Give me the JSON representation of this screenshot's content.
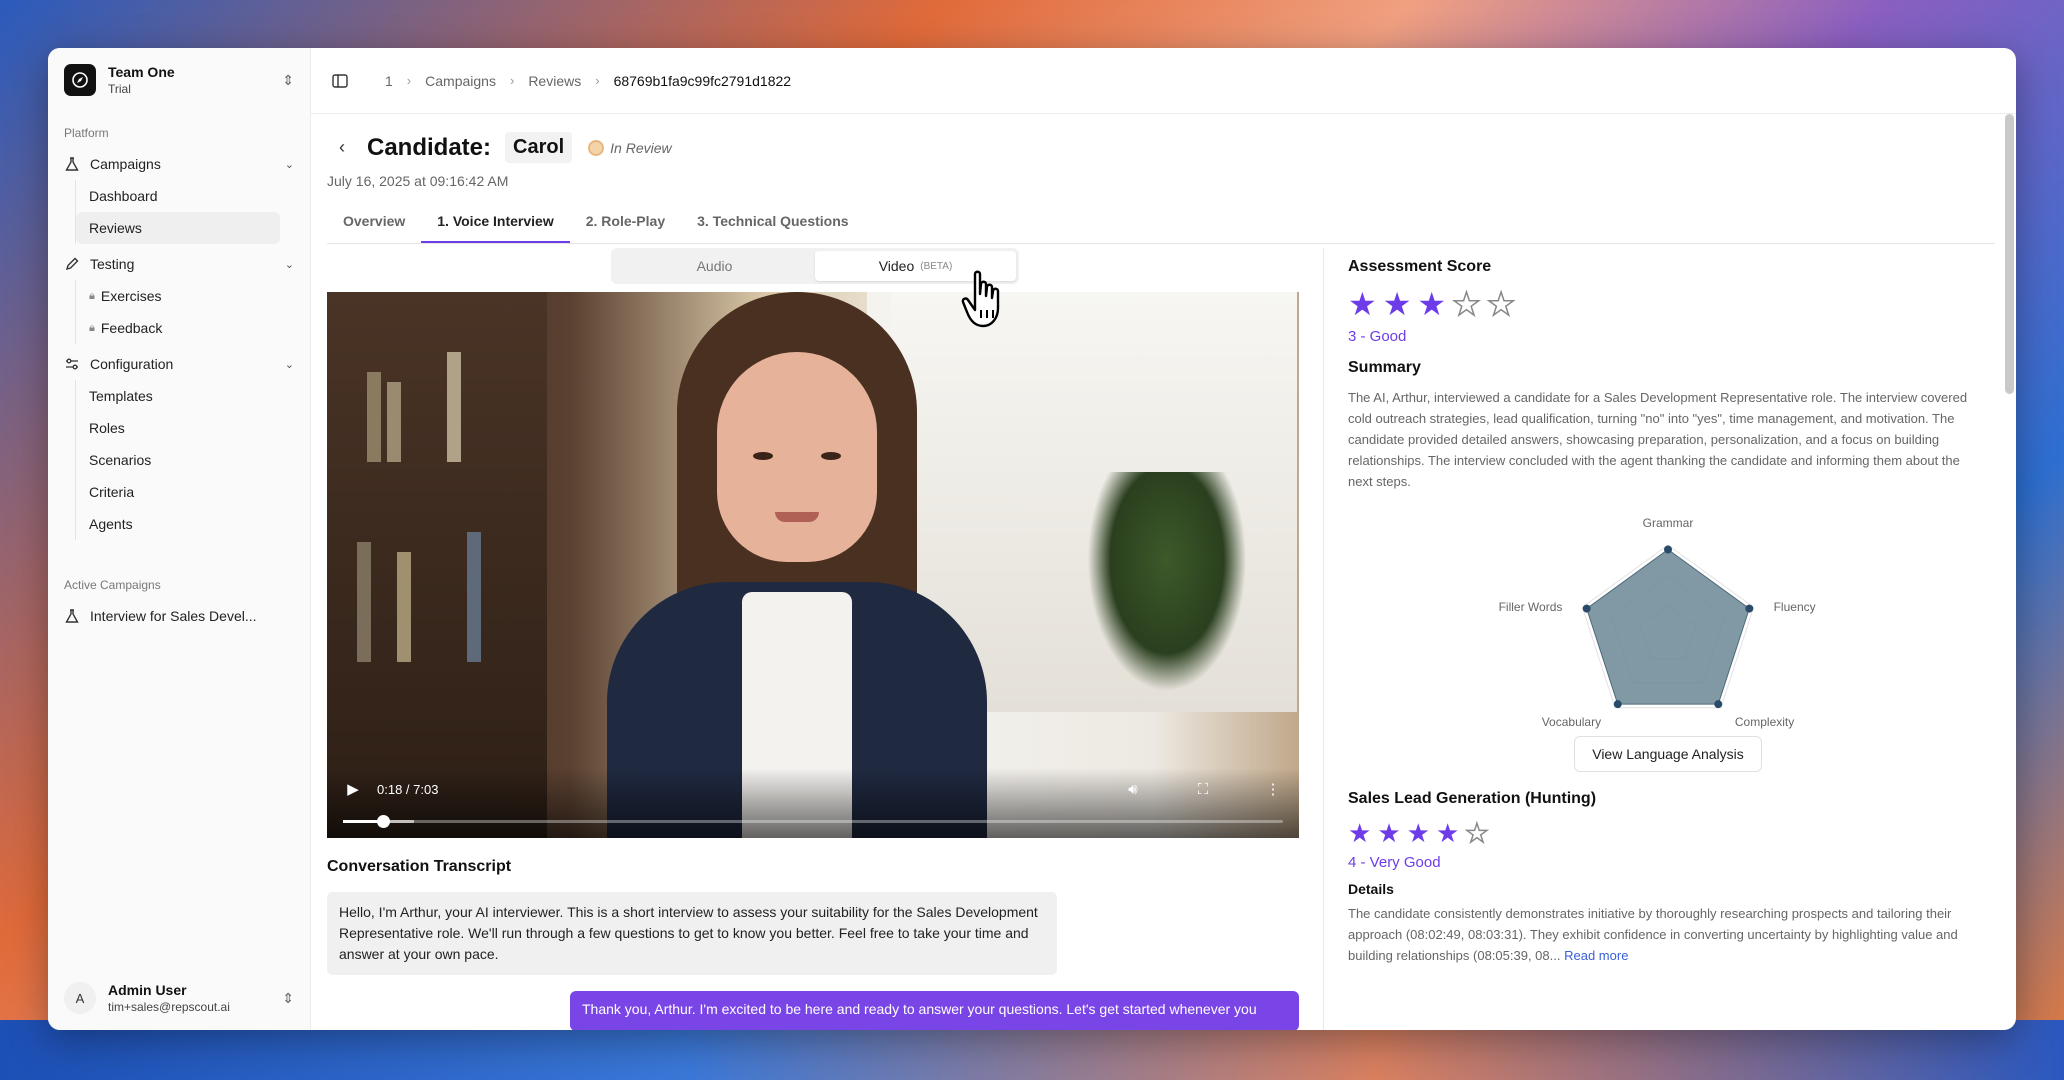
{
  "team": {
    "name": "Team One",
    "plan": "Trial"
  },
  "sidebar": {
    "platform_label": "Platform",
    "groups": [
      {
        "label": "Campaigns",
        "icon": "flask-icon",
        "items": [
          {
            "label": "Dashboard"
          },
          {
            "label": "Reviews",
            "active": true
          }
        ]
      },
      {
        "label": "Testing",
        "icon": "pencil-icon",
        "items": [
          {
            "label": "Exercises",
            "locked": true
          },
          {
            "label": "Feedback",
            "locked": true
          }
        ]
      },
      {
        "label": "Configuration",
        "icon": "sliders-icon",
        "items": [
          {
            "label": "Templates"
          },
          {
            "label": "Roles"
          },
          {
            "label": "Scenarios"
          },
          {
            "label": "Criteria"
          },
          {
            "label": "Agents"
          }
        ]
      }
    ],
    "active_campaigns_label": "Active Campaigns",
    "active_campaigns": [
      {
        "label": "Interview for Sales Devel..."
      }
    ]
  },
  "user": {
    "initial": "A",
    "name": "Admin User",
    "email": "tim+sales@repscout.ai"
  },
  "breadcrumb": [
    "1",
    "Campaigns",
    "Reviews",
    "68769b1fa9c99fc2791d1822"
  ],
  "candidate": {
    "title": "Candidate:",
    "name": "Carol",
    "status": "In Review",
    "date": "July 16, 2025 at 09:16:42 AM"
  },
  "tabs": [
    {
      "label": "Overview",
      "active": false
    },
    {
      "label": "1. Voice Interview",
      "active": true
    },
    {
      "label": "2. Role-Play",
      "active": false
    },
    {
      "label": "3. Technical Questions",
      "active": false
    }
  ],
  "media_toggle": {
    "audio": "Audio",
    "video": "Video",
    "beta": "(BETA)",
    "selected": "video"
  },
  "video": {
    "time": "0:18 / 7:03",
    "progress": 0.0425,
    "buffered": 0.075
  },
  "transcript": {
    "title": "Conversation Transcript",
    "ai_message": "Hello, I'm Arthur, your AI interviewer. This is a short interview to assess your suitability for the Sales Development Representative role. We'll run through a few questions to get to know you better. Feel free to take your time and answer at your own pace.",
    "user_message": "Thank you, Arthur. I'm excited to be here and ready to answer your questions. Let's get started whenever you"
  },
  "assessment": {
    "title": "Assessment Score",
    "rating": 3,
    "max": 5,
    "label": "3 - Good",
    "summary_title": "Summary",
    "summary": "The AI, Arthur, interviewed a candidate for a Sales Development Representative role. The interview covered cold outreach strategies, lead qualification, turning \"no\" into \"yes\", time management, and motivation. The candidate provided detailed answers, showcasing preparation, personalization, and a focus on building relationships. The interview concluded with the agent thanking the candidate and informing them about the next steps."
  },
  "radar": {
    "axes": [
      "Grammar",
      "Fluency",
      "Complexity",
      "Vocabulary",
      "Filler Words"
    ],
    "values": [
      0.95,
      0.95,
      0.95,
      0.95,
      0.95
    ],
    "fill_color": "#6b8795",
    "button": "View Language Analysis"
  },
  "sales_lead": {
    "title": "Sales Lead Generation (Hunting)",
    "rating": 4,
    "max": 5,
    "label": "4 - Very Good",
    "details_label": "Details",
    "details": "The candidate consistently demonstrates initiative by thoroughly researching prospects and tailoring their approach (08:02:49, 08:03:31). They exhibit confidence in converting uncertainty by highlighting value and building relationships (08:05:39, 08...",
    "read_more": "Read more"
  },
  "colors": {
    "accent": "#6d3ce8",
    "user_bubble": "#7a45e6"
  }
}
